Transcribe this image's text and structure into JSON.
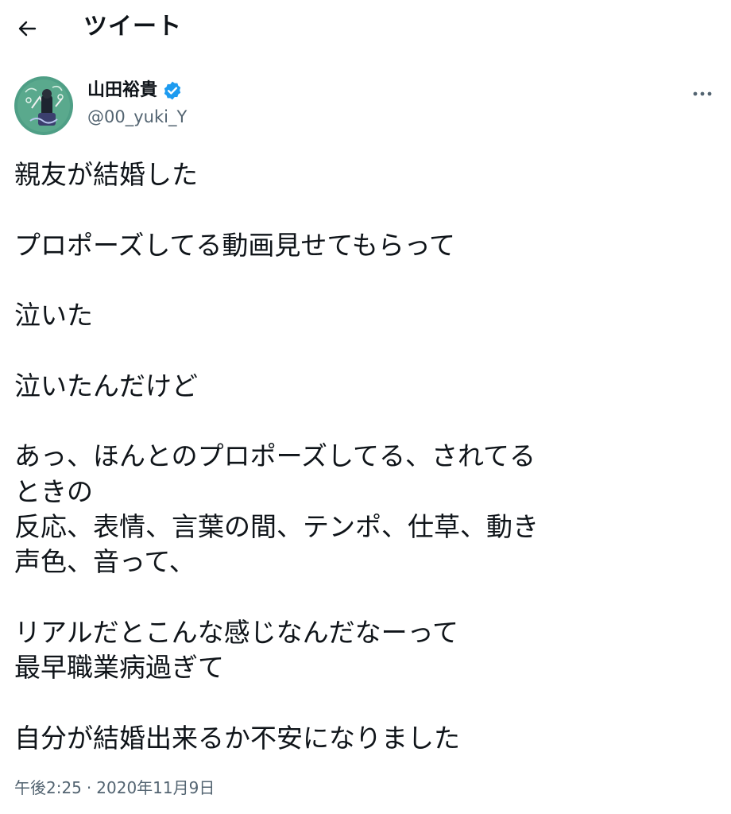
{
  "header": {
    "back_icon": "arrow-left-icon",
    "title": "ツイート"
  },
  "author": {
    "display_name": "山田裕貴",
    "verified_icon": "verified-badge-icon",
    "verified_color": "#1d9bf0",
    "handle": "@00_yuki_Y",
    "more_icon": "more-horizontal-icon"
  },
  "tweet": {
    "lines": [
      "親友が結婚した",
      "",
      "プロポーズしてる動画見せてもらって",
      "",
      "泣いた",
      "",
      "泣いたんだけど",
      "",
      "あっ、ほんとのプロポーズしてる、されてる",
      "ときの",
      "反応、表情、言葉の間、テンポ、仕草、動き",
      "声色、音って、",
      "",
      "リアルだとこんな感じなんだなーって",
      "最早職業病過ぎて",
      "",
      "自分が結婚出来るか不安になりました"
    ]
  },
  "meta": {
    "time": "午後2:25",
    "separator": "·",
    "date": "2020年11月9日"
  },
  "colors": {
    "text": "#0f1419",
    "secondary": "#536471",
    "avatar_bg": "#4f9f86"
  }
}
